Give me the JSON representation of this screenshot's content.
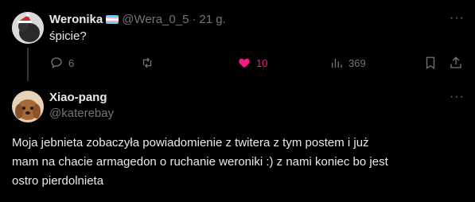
{
  "post1": {
    "display_name": "Weronika",
    "handle": "@Wera_0_5",
    "separator": "·",
    "time": "21 g.",
    "text": "śpicie?",
    "replies": "6",
    "retweets": "",
    "likes": "10",
    "views": "369",
    "liked": true
  },
  "post2": {
    "display_name": "Xiao-pang",
    "handle": "@katerebay",
    "text_line1": "Moja jebnieta zobaczyła powiadomienie z twitera z tym postem i już",
    "text_line2": "mam na chacie armagedon o ruchanie weroniki :) z nami koniec bo jest",
    "text_line3": "ostro pierdolnieta"
  },
  "more_label": "···",
  "colors": {
    "background": "#000000",
    "text": "#e7e9ea",
    "muted": "#71767b",
    "like": "#f91880",
    "thread_line": "#333639"
  },
  "icons": [
    "reply-icon",
    "retweet-icon",
    "like-icon",
    "views-icon",
    "bookmark-icon",
    "share-icon",
    "more-icon",
    "trans-flag-icon"
  ]
}
